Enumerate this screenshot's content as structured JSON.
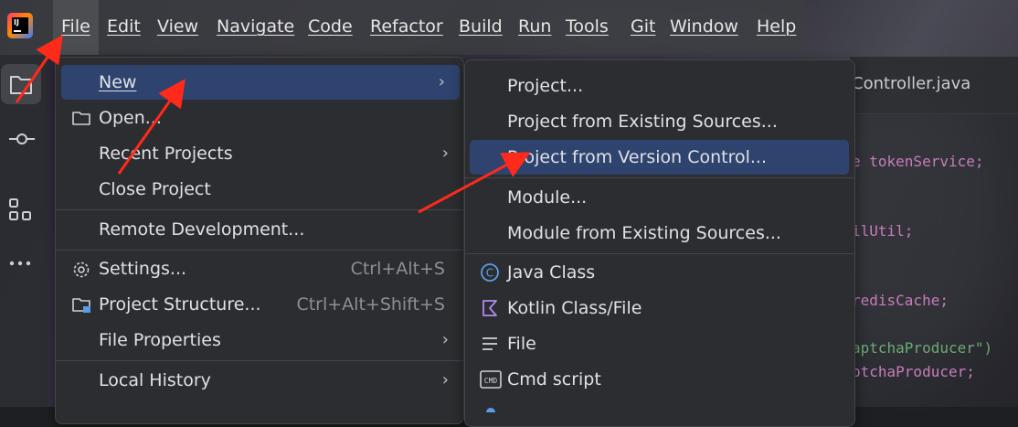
{
  "menubar": {
    "items": [
      "File",
      "Edit",
      "View",
      "Navigate",
      "Code",
      "Refactor",
      "Build",
      "Run",
      "Tools",
      "Git",
      "Window",
      "Help"
    ]
  },
  "editor": {
    "tab_title": "Controller.java",
    "code_lines": [
      {
        "text": "e tokenService;",
        "color": "#c77dbb"
      },
      {
        "text": "ilUtil;",
        "color": "#c77dbb"
      },
      {
        "text": "redisCache;",
        "color": "#c77dbb"
      },
      {
        "text": "aptchaProducer\")",
        "color": "#6aab73"
      },
      {
        "text": "ptchaProducer;",
        "color": "#c77dbb"
      }
    ]
  },
  "file_menu": {
    "new": "New",
    "open": "Open...",
    "recent_projects": "Recent Projects",
    "close_project": "Close Project",
    "remote_development": "Remote Development...",
    "settings": "Settings...",
    "settings_shortcut": "Ctrl+Alt+S",
    "project_structure": "Project Structure...",
    "project_structure_shortcut": "Ctrl+Alt+Shift+S",
    "file_properties": "File Properties",
    "local_history": "Local History"
  },
  "new_menu": {
    "project": "Project...",
    "project_existing": "Project from Existing Sources...",
    "project_vcs": "Project from Version Control...",
    "module": "Module...",
    "module_existing": "Module from Existing Sources...",
    "java_class": "Java Class",
    "kotlin_class": "Kotlin Class/File",
    "file": "File",
    "cmd_script": "Cmd script"
  },
  "colors": {
    "accent_selection": "#2e436e",
    "annotation_arrow": "#ff2a1a",
    "java_icon": "#5c9ce6",
    "kotlin_icon": "#b18cf0"
  }
}
